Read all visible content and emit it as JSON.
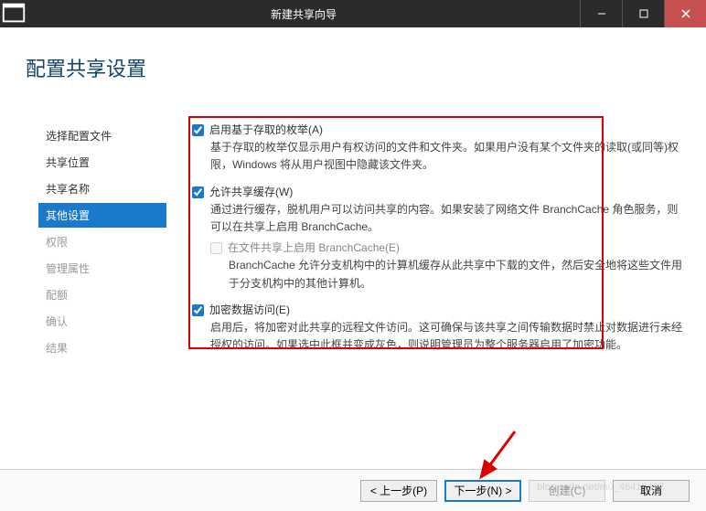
{
  "window": {
    "title": "新建共享向导",
    "min_label": "Minimize",
    "max_label": "Maximize",
    "close_label": "Close"
  },
  "heading": "配置共享设置",
  "sidebar": {
    "items": [
      {
        "label": "选择配置文件",
        "state": "done"
      },
      {
        "label": "共享位置",
        "state": "done"
      },
      {
        "label": "共享名称",
        "state": "done"
      },
      {
        "label": "其他设置",
        "state": "active"
      },
      {
        "label": "权限",
        "state": "pending"
      },
      {
        "label": "管理属性",
        "state": "pending"
      },
      {
        "label": "配额",
        "state": "pending"
      },
      {
        "label": "确认",
        "state": "pending"
      },
      {
        "label": "结果",
        "state": "pending"
      }
    ]
  },
  "options": {
    "enum": {
      "checked": true,
      "label": "启用基于存取的枚举(A)",
      "accel": "A",
      "desc": "基于存取的枚举仅显示用户有权访问的文件和文件夹。如果用户没有某个文件夹的读取(或同等)权限，Windows 将从用户视图中隐藏该文件夹。"
    },
    "cache": {
      "checked": true,
      "label": "允许共享缓存(W)",
      "accel": "W",
      "desc": "通过进行缓存，脱机用户可以访问共享的内容。如果安装了网络文件 BranchCache 角色服务，则可以在共享上启用 BranchCache。",
      "sub": {
        "checked": false,
        "disabled": true,
        "label": "在文件共享上启用 BranchCache(E)",
        "accel": "E",
        "desc": "BranchCache 允许分支机构中的计算机缓存从此共享中下载的文件，然后安全地将这些文件用于分支机构中的其他计算机。"
      }
    },
    "encrypt": {
      "checked": true,
      "label": "加密数据访问(E)",
      "accel": "E",
      "desc": "启用后，将加密对此共享的远程文件访问。这可确保与该共享之间传输数据时禁止对数据进行未经授权的访问。如果选中此框并变成灰色，则说明管理员为整个服务器启用了加密功能。"
    }
  },
  "footer": {
    "prev": "< 上一步(P)",
    "next": "下一步(N) >",
    "create": "创建(C)",
    "cancel": "取消"
  },
  "watermark": "blog.csdn.net/m0_46418417",
  "colors": {
    "accent": "#1979ca",
    "highlight_border": "#d00",
    "close_btn": "#c75050"
  }
}
